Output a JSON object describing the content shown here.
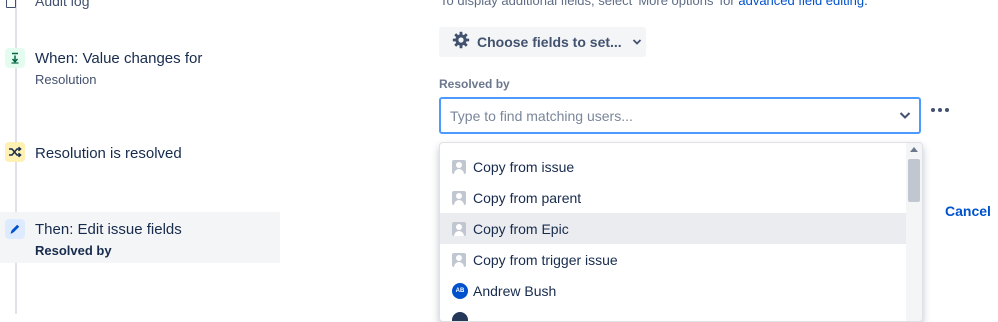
{
  "rule": {
    "audit_label": "Audit log",
    "trigger": {
      "title": "When: Value changes for",
      "subtitle": "Resolution"
    },
    "condition": {
      "title": "Resolution is resolved"
    },
    "action": {
      "title": "Then: Edit issue fields",
      "subtitle": "Resolved by"
    }
  },
  "config": {
    "hint_prefix": "To display additional fields, select 'More options' for",
    "hint_link": "advanced field editing.",
    "choose_fields_label": "Choose fields to set...",
    "field_label": "Resolved by",
    "search_placeholder": "Type to find matching users...",
    "search_value": "",
    "cancel_label": "Cancel"
  },
  "dropdown": {
    "options": [
      {
        "label": "Copy from issue",
        "icon": "user-placeholder-icon"
      },
      {
        "label": "Copy from parent",
        "icon": "user-placeholder-icon"
      },
      {
        "label": "Copy from Epic",
        "icon": "user-placeholder-icon",
        "highlighted": true
      },
      {
        "label": "Copy from trigger issue",
        "icon": "user-placeholder-icon"
      },
      {
        "label": "Andrew Bush",
        "icon": "user-avatar",
        "initials": "AB"
      }
    ]
  },
  "colors": {
    "accent": "#0052cc",
    "focus_border": "#4c9aff",
    "trigger_bg": "#e3fcef",
    "condition_bg": "#fff0b3",
    "action_bg": "#deebff",
    "selected_step_bg": "#f4f5f7"
  }
}
